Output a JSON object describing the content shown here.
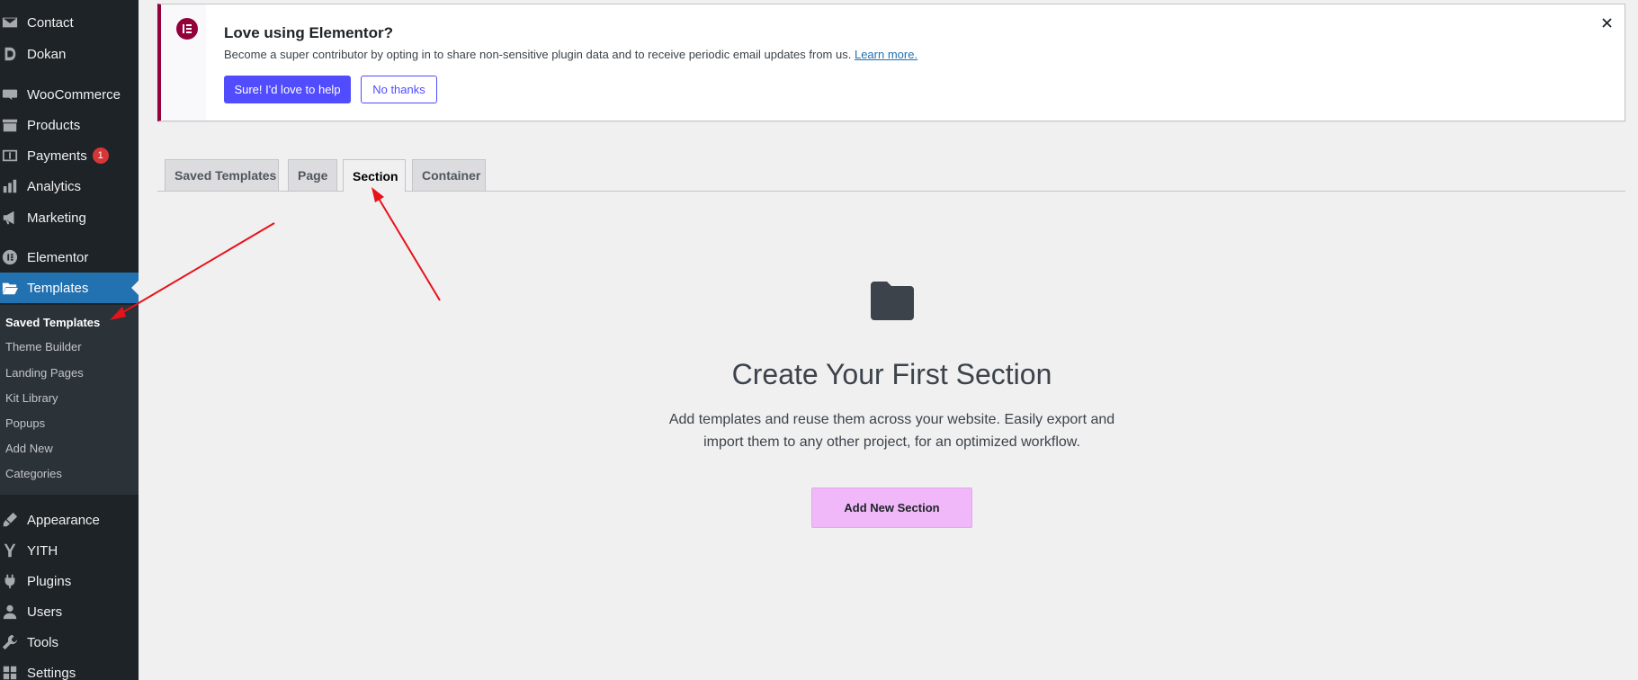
{
  "sidebar": {
    "items": [
      {
        "label": "Contact",
        "icon": "mail-icon"
      },
      {
        "label": "Dokan",
        "icon": "dokan-icon"
      },
      {
        "label": "WooCommerce",
        "icon": "woocommerce-icon"
      },
      {
        "label": "Products",
        "icon": "archive-icon"
      },
      {
        "label": "Payments",
        "icon": "dollar-icon",
        "badge": "1"
      },
      {
        "label": "Analytics",
        "icon": "bar-chart-icon"
      },
      {
        "label": "Marketing",
        "icon": "megaphone-icon"
      },
      {
        "label": "Elementor",
        "icon": "elementor-icon"
      },
      {
        "label": "Templates",
        "icon": "folder-open-icon"
      },
      {
        "label": "Appearance",
        "icon": "paintbrush-icon"
      },
      {
        "label": "YITH",
        "icon": "yith-icon"
      },
      {
        "label": "Plugins",
        "icon": "plug-icon"
      },
      {
        "label": "Users",
        "icon": "user-icon"
      },
      {
        "label": "Tools",
        "icon": "wrench-icon"
      },
      {
        "label": "Settings",
        "icon": "settings-icon"
      }
    ],
    "submenu": [
      "Saved Templates",
      "Theme Builder",
      "Landing Pages",
      "Kit Library",
      "Popups",
      "Add New",
      "Categories"
    ]
  },
  "notice": {
    "title": "Love using Elementor?",
    "text": "Become a super contributor by opting in to share non-sensitive plugin data and to receive periodic email updates from us.",
    "link": "Learn more.",
    "primary_button": "Sure! I'd love to help",
    "secondary_button": "No thanks",
    "close": "✕"
  },
  "tabs": [
    "Saved Templates",
    "Page",
    "Section",
    "Container"
  ],
  "empty_state": {
    "title": "Create Your First Section",
    "text_line1": "Add templates and reuse them across your website. Easily export and",
    "text_line2": "import them to any other project, for an optimized workflow.",
    "button": "Add New Section"
  },
  "colors": {
    "sidebar_bg": "#1d2327",
    "active_menu": "#2271b1",
    "elementor_brand": "#93003c",
    "primary_button": "#524cff",
    "add_button": "#f0b8f8",
    "annotation_arrow": "#e8121a"
  }
}
